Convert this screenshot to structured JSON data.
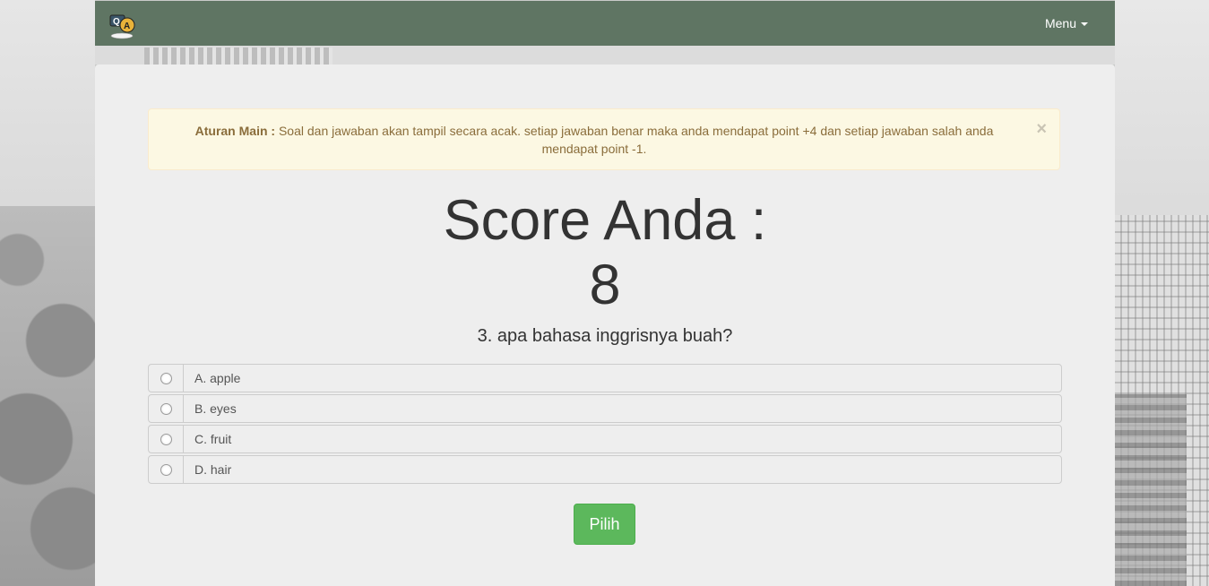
{
  "navbar": {
    "menu_label": "Menu"
  },
  "alert": {
    "title": "Aturan Main :",
    "text": "Soal dan jawaban akan tampil secara acak. setiap jawaban benar maka anda mendapat point +4 dan setiap jawaban salah anda mendapat point -1.",
    "close": "×"
  },
  "score": {
    "label": "Score Anda :",
    "value": "8"
  },
  "question": {
    "text": "3. apa bahasa inggrisnya buah?"
  },
  "options": [
    {
      "label": "A. apple"
    },
    {
      "label": "B. eyes"
    },
    {
      "label": "C. fruit"
    },
    {
      "label": "D. hair"
    }
  ],
  "submit": {
    "label": "Pilih"
  },
  "colors": {
    "navbar": "#5f7563",
    "button": "#5cb85c",
    "alert_bg": "#fcf8e3",
    "alert_text": "#8a6d3b"
  }
}
